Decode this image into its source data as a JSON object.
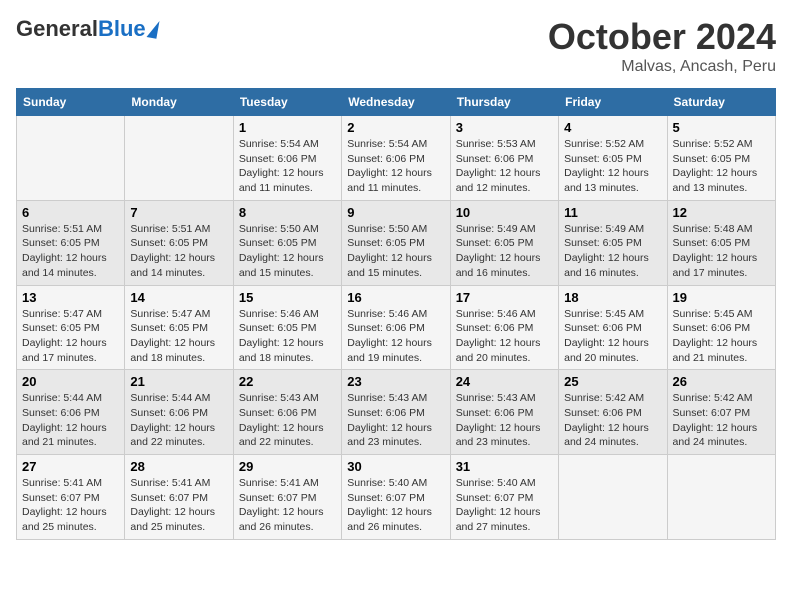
{
  "logo": {
    "general": "General",
    "blue": "Blue"
  },
  "title": "October 2024",
  "location": "Malvas, Ancash, Peru",
  "days_header": [
    "Sunday",
    "Monday",
    "Tuesday",
    "Wednesday",
    "Thursday",
    "Friday",
    "Saturday"
  ],
  "weeks": [
    [
      {
        "day": "",
        "sunrise": "",
        "sunset": "",
        "daylight": ""
      },
      {
        "day": "",
        "sunrise": "",
        "sunset": "",
        "daylight": ""
      },
      {
        "day": "1",
        "sunrise": "Sunrise: 5:54 AM",
        "sunset": "Sunset: 6:06 PM",
        "daylight": "Daylight: 12 hours and 11 minutes."
      },
      {
        "day": "2",
        "sunrise": "Sunrise: 5:54 AM",
        "sunset": "Sunset: 6:06 PM",
        "daylight": "Daylight: 12 hours and 11 minutes."
      },
      {
        "day": "3",
        "sunrise": "Sunrise: 5:53 AM",
        "sunset": "Sunset: 6:06 PM",
        "daylight": "Daylight: 12 hours and 12 minutes."
      },
      {
        "day": "4",
        "sunrise": "Sunrise: 5:52 AM",
        "sunset": "Sunset: 6:05 PM",
        "daylight": "Daylight: 12 hours and 13 minutes."
      },
      {
        "day": "5",
        "sunrise": "Sunrise: 5:52 AM",
        "sunset": "Sunset: 6:05 PM",
        "daylight": "Daylight: 12 hours and 13 minutes."
      }
    ],
    [
      {
        "day": "6",
        "sunrise": "Sunrise: 5:51 AM",
        "sunset": "Sunset: 6:05 PM",
        "daylight": "Daylight: 12 hours and 14 minutes."
      },
      {
        "day": "7",
        "sunrise": "Sunrise: 5:51 AM",
        "sunset": "Sunset: 6:05 PM",
        "daylight": "Daylight: 12 hours and 14 minutes."
      },
      {
        "day": "8",
        "sunrise": "Sunrise: 5:50 AM",
        "sunset": "Sunset: 6:05 PM",
        "daylight": "Daylight: 12 hours and 15 minutes."
      },
      {
        "day": "9",
        "sunrise": "Sunrise: 5:50 AM",
        "sunset": "Sunset: 6:05 PM",
        "daylight": "Daylight: 12 hours and 15 minutes."
      },
      {
        "day": "10",
        "sunrise": "Sunrise: 5:49 AM",
        "sunset": "Sunset: 6:05 PM",
        "daylight": "Daylight: 12 hours and 16 minutes."
      },
      {
        "day": "11",
        "sunrise": "Sunrise: 5:49 AM",
        "sunset": "Sunset: 6:05 PM",
        "daylight": "Daylight: 12 hours and 16 minutes."
      },
      {
        "day": "12",
        "sunrise": "Sunrise: 5:48 AM",
        "sunset": "Sunset: 6:05 PM",
        "daylight": "Daylight: 12 hours and 17 minutes."
      }
    ],
    [
      {
        "day": "13",
        "sunrise": "Sunrise: 5:47 AM",
        "sunset": "Sunset: 6:05 PM",
        "daylight": "Daylight: 12 hours and 17 minutes."
      },
      {
        "day": "14",
        "sunrise": "Sunrise: 5:47 AM",
        "sunset": "Sunset: 6:05 PM",
        "daylight": "Daylight: 12 hours and 18 minutes."
      },
      {
        "day": "15",
        "sunrise": "Sunrise: 5:46 AM",
        "sunset": "Sunset: 6:05 PM",
        "daylight": "Daylight: 12 hours and 18 minutes."
      },
      {
        "day": "16",
        "sunrise": "Sunrise: 5:46 AM",
        "sunset": "Sunset: 6:06 PM",
        "daylight": "Daylight: 12 hours and 19 minutes."
      },
      {
        "day": "17",
        "sunrise": "Sunrise: 5:46 AM",
        "sunset": "Sunset: 6:06 PM",
        "daylight": "Daylight: 12 hours and 20 minutes."
      },
      {
        "day": "18",
        "sunrise": "Sunrise: 5:45 AM",
        "sunset": "Sunset: 6:06 PM",
        "daylight": "Daylight: 12 hours and 20 minutes."
      },
      {
        "day": "19",
        "sunrise": "Sunrise: 5:45 AM",
        "sunset": "Sunset: 6:06 PM",
        "daylight": "Daylight: 12 hours and 21 minutes."
      }
    ],
    [
      {
        "day": "20",
        "sunrise": "Sunrise: 5:44 AM",
        "sunset": "Sunset: 6:06 PM",
        "daylight": "Daylight: 12 hours and 21 minutes."
      },
      {
        "day": "21",
        "sunrise": "Sunrise: 5:44 AM",
        "sunset": "Sunset: 6:06 PM",
        "daylight": "Daylight: 12 hours and 22 minutes."
      },
      {
        "day": "22",
        "sunrise": "Sunrise: 5:43 AM",
        "sunset": "Sunset: 6:06 PM",
        "daylight": "Daylight: 12 hours and 22 minutes."
      },
      {
        "day": "23",
        "sunrise": "Sunrise: 5:43 AM",
        "sunset": "Sunset: 6:06 PM",
        "daylight": "Daylight: 12 hours and 23 minutes."
      },
      {
        "day": "24",
        "sunrise": "Sunrise: 5:43 AM",
        "sunset": "Sunset: 6:06 PM",
        "daylight": "Daylight: 12 hours and 23 minutes."
      },
      {
        "day": "25",
        "sunrise": "Sunrise: 5:42 AM",
        "sunset": "Sunset: 6:06 PM",
        "daylight": "Daylight: 12 hours and 24 minutes."
      },
      {
        "day": "26",
        "sunrise": "Sunrise: 5:42 AM",
        "sunset": "Sunset: 6:07 PM",
        "daylight": "Daylight: 12 hours and 24 minutes."
      }
    ],
    [
      {
        "day": "27",
        "sunrise": "Sunrise: 5:41 AM",
        "sunset": "Sunset: 6:07 PM",
        "daylight": "Daylight: 12 hours and 25 minutes."
      },
      {
        "day": "28",
        "sunrise": "Sunrise: 5:41 AM",
        "sunset": "Sunset: 6:07 PM",
        "daylight": "Daylight: 12 hours and 25 minutes."
      },
      {
        "day": "29",
        "sunrise": "Sunrise: 5:41 AM",
        "sunset": "Sunset: 6:07 PM",
        "daylight": "Daylight: 12 hours and 26 minutes."
      },
      {
        "day": "30",
        "sunrise": "Sunrise: 5:40 AM",
        "sunset": "Sunset: 6:07 PM",
        "daylight": "Daylight: 12 hours and 26 minutes."
      },
      {
        "day": "31",
        "sunrise": "Sunrise: 5:40 AM",
        "sunset": "Sunset: 6:07 PM",
        "daylight": "Daylight: 12 hours and 27 minutes."
      },
      {
        "day": "",
        "sunrise": "",
        "sunset": "",
        "daylight": ""
      },
      {
        "day": "",
        "sunrise": "",
        "sunset": "",
        "daylight": ""
      }
    ]
  ]
}
